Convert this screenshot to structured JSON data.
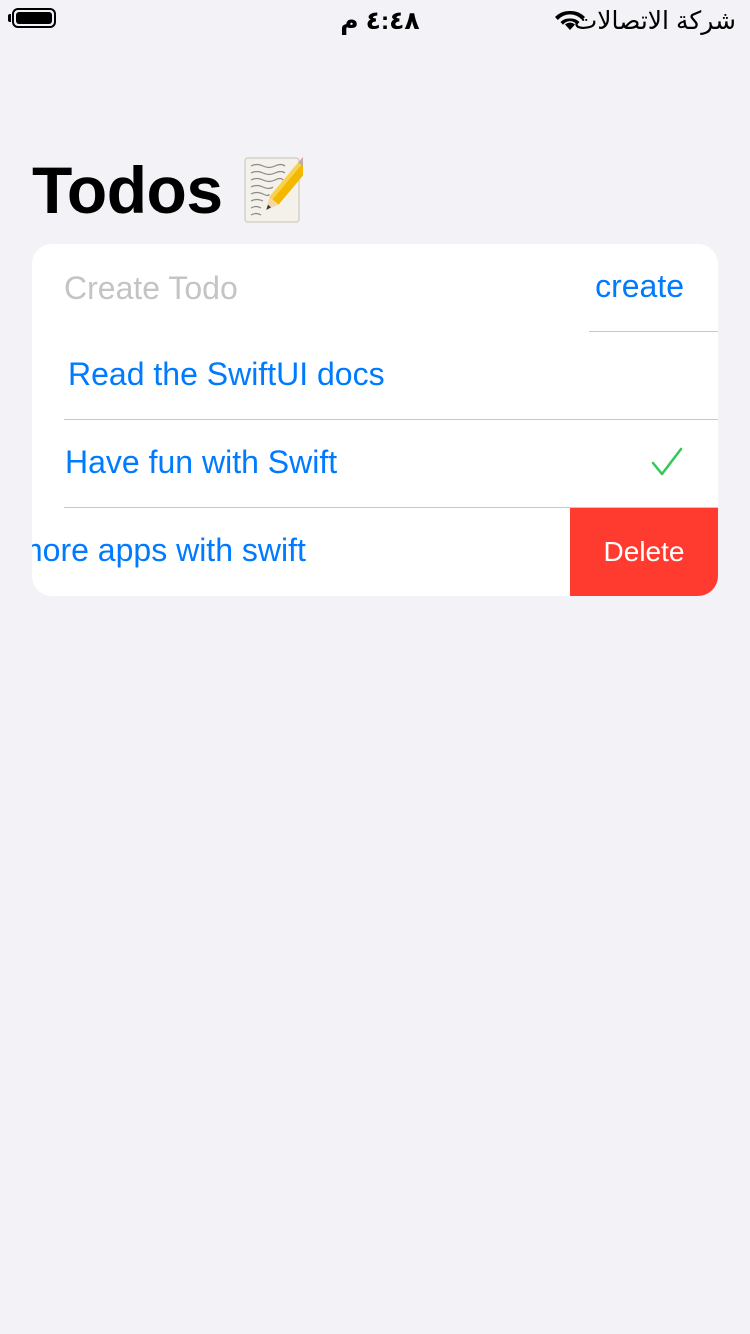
{
  "status_bar": {
    "time": "٤:٤٨ م",
    "carrier": "شركة الاتصالات",
    "battery_icon": "battery-full-icon",
    "wifi_icon": "wifi-icon"
  },
  "header": {
    "title": "Todos",
    "title_icon": "memo-pencil-icon"
  },
  "create_row": {
    "placeholder": "Create Todo",
    "value": "",
    "button_label": "create"
  },
  "todos": [
    {
      "label": "Read the SwiftUI docs",
      "completed": false
    },
    {
      "label": "Have fun with Swift",
      "completed": true
    },
    {
      "label": "more apps with swift",
      "completed": false,
      "swiped": true,
      "delete_label": "Delete"
    }
  ],
  "colors": {
    "background": "#f2f2f7",
    "accent": "#007aff",
    "delete": "#ff3b30",
    "check": "#34c759",
    "placeholder": "#c4c4c6"
  }
}
